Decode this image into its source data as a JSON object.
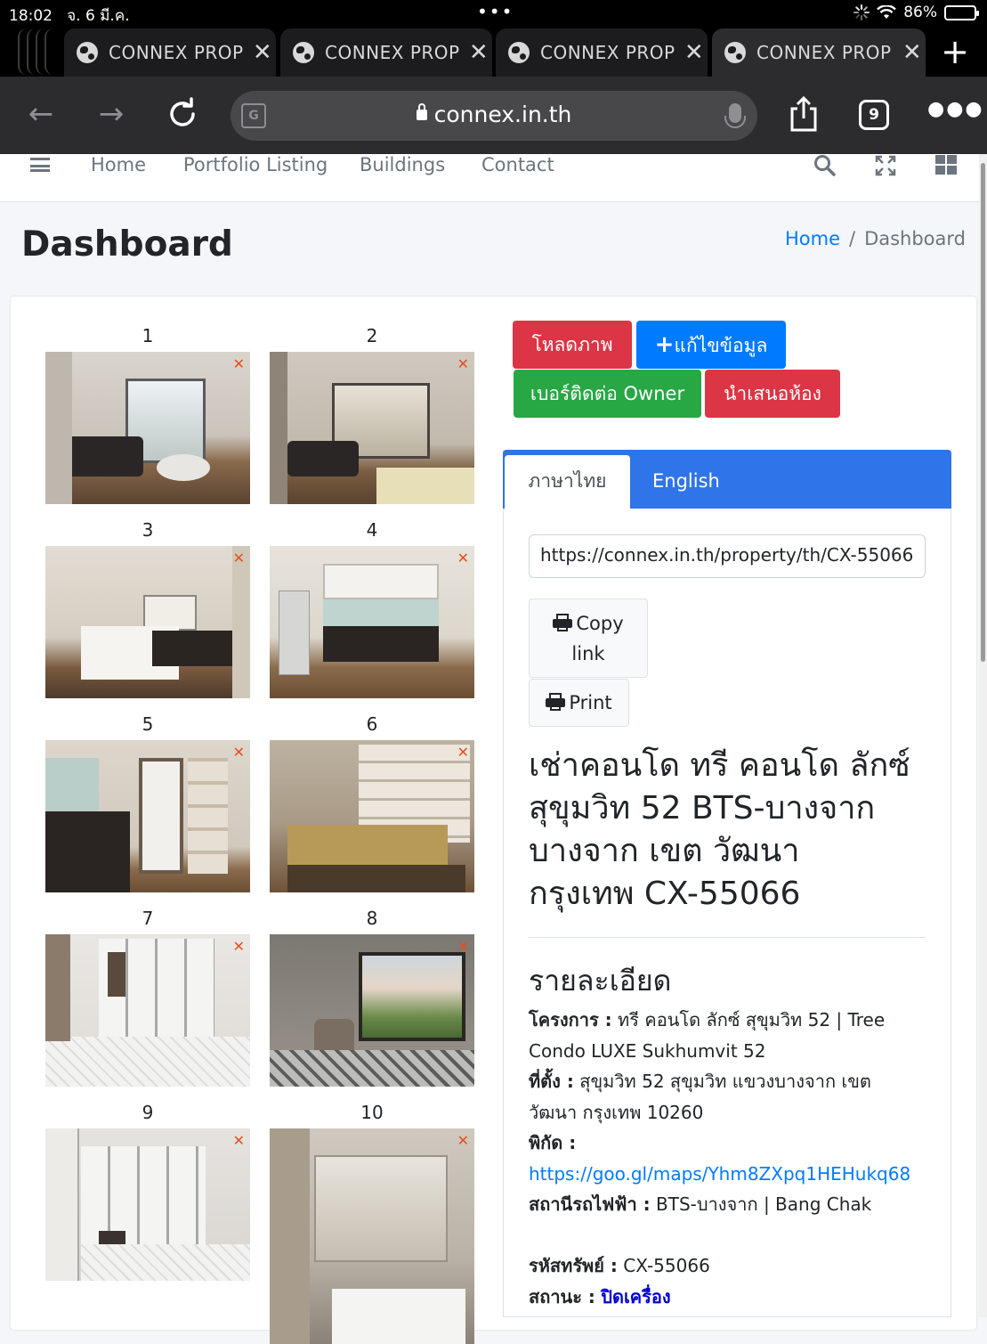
{
  "status_bar": {
    "time": "18:02",
    "date": "จ. 6 มี.ค.",
    "battery": "86%"
  },
  "browser_tabs": [
    {
      "title": "CONNEX PROP"
    },
    {
      "title": "CONNEX PROP"
    },
    {
      "title": "CONNEX PROP"
    },
    {
      "title": "CONNEX PROP"
    }
  ],
  "address_bar": {
    "url": "connex.in.th",
    "tab_count": "9"
  },
  "site_nav": {
    "links": [
      "Home",
      "Portfolio Listing",
      "Buildings",
      "Contact"
    ]
  },
  "page": {
    "title": "Dashboard",
    "breadcrumb": {
      "home": "Home",
      "separator": "/",
      "current": "Dashboard"
    }
  },
  "gallery": {
    "numbers": [
      "1",
      "2",
      "3",
      "4",
      "5",
      "6",
      "7",
      "8",
      "9",
      "10"
    ]
  },
  "actions": {
    "download_images": "โหลดภาพ",
    "edit_info": "แก้ไขข้อมูล",
    "owner_contact": "เบอร์ติดต่อ Owner",
    "present_room": "นำเสนอห้อง"
  },
  "language_tabs": {
    "thai": "ภาษาไทย",
    "english": "English"
  },
  "share": {
    "link_value": "https://connex.in.th/property/th/CX-55066",
    "copy_link_line1": "Copy",
    "copy_link_line2": "link",
    "print": "Print"
  },
  "property": {
    "title_lines": [
      "เช่าคอนโด ทรี คอนโด ลักซ์",
      "สุขุมวิท 52 BTS-บางจาก",
      "บางจาก เขต วัฒนา",
      "กรุงเทพ CX-55066"
    ],
    "details_heading": "รายละเอียด",
    "project_label": "โครงการ :",
    "project_value_1": "ทรี คอนโด ลักซ์ สุขุมวิท 52 | Tree",
    "project_value_2": "Condo LUXE Sukhumvit 52",
    "location_label": "ที่ตั้ง :",
    "location_value_1": "สุขุมวิท 52 สุขุมวิท แขวงบางจาก เขต",
    "location_value_2": "วัฒนา กรุงเทพ 10260",
    "coords_label": "พิกัด :",
    "coords_link": "https://goo.gl/maps/Yhm8ZXpq1HEHukq68",
    "station_label": "สถานีรถไฟฟ้า :",
    "station_value": "BTS-บางจาก | Bang Chak",
    "code_label": "รหัสทรัพย์ :",
    "code_value": "CX-55066",
    "status_label": "สถานะ :",
    "status_value": "ปิดเครื่อง"
  },
  "colors": {
    "red": "#dc3545",
    "blue": "#007bff",
    "green": "#28a745",
    "tab_header": "#2f74e8"
  }
}
